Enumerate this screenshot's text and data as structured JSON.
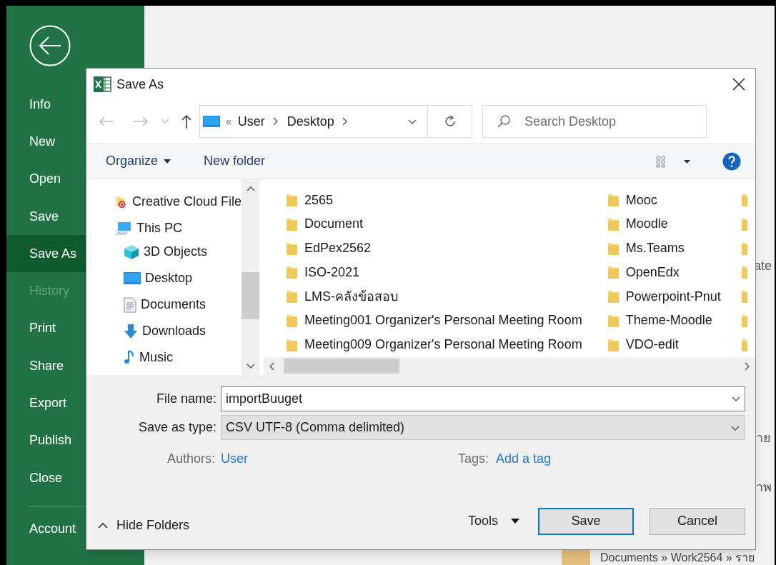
{
  "backstage": {
    "menu": [
      {
        "label": "Info",
        "selected": false,
        "disabled": false
      },
      {
        "label": "New",
        "selected": false,
        "disabled": false
      },
      {
        "label": "Open",
        "selected": false,
        "disabled": false
      },
      {
        "label": "Save",
        "selected": false,
        "disabled": false
      },
      {
        "label": "Save As",
        "selected": true,
        "disabled": false
      },
      {
        "label": "History",
        "selected": false,
        "disabled": true
      },
      {
        "label": "Print",
        "selected": false,
        "disabled": false
      },
      {
        "label": "Share",
        "selected": false,
        "disabled": false
      },
      {
        "label": "Export",
        "selected": false,
        "disabled": false
      },
      {
        "label": "Publish",
        "selected": false,
        "disabled": false
      },
      {
        "label": "Close",
        "selected": false,
        "disabled": false
      }
    ],
    "account": "Account",
    "behind_texts": [
      "ate",
      "าย",
      "าพ"
    ],
    "behind_path": "Documents » Work2564 » ราย"
  },
  "dialog": {
    "title": "Save As",
    "breadcrumb": {
      "overflow": "«",
      "parts": [
        "User",
        "Desktop"
      ]
    },
    "search": {
      "placeholder": "Search Desktop"
    },
    "toolbar": {
      "organize": "Organize",
      "new_folder": "New folder"
    },
    "nav_pane": [
      {
        "label": "Creative Cloud File",
        "kind": "cloud"
      },
      {
        "label": "This PC",
        "kind": "pc",
        "children": [
          {
            "label": "3D Objects",
            "kind": "cube"
          },
          {
            "label": "Desktop",
            "kind": "desktop"
          },
          {
            "label": "Documents",
            "kind": "documents"
          },
          {
            "label": "Downloads",
            "kind": "downloads"
          },
          {
            "label": "Music",
            "kind": "music"
          }
        ]
      }
    ],
    "folders": [
      {
        "label": "2565"
      },
      {
        "label": "Document"
      },
      {
        "label": "EdPex2562"
      },
      {
        "label": "ISO-2021"
      },
      {
        "label": "LMS-คลังข้อสอบ"
      },
      {
        "label": "Meeting001 Organizer's Personal Meeting Room"
      },
      {
        "label": "Meeting009 Organizer's Personal Meeting Room"
      },
      {
        "label": "Mooc"
      },
      {
        "label": "Moodle"
      },
      {
        "label": "Ms.Teams"
      },
      {
        "label": "OpenEdx"
      },
      {
        "label": "Powerpoint-Pnut"
      },
      {
        "label": "Theme-Moodle"
      },
      {
        "label": "VDO-edit"
      }
    ],
    "cut_folders": [
      {
        "kind": "folder"
      },
      {
        "kind": "folder"
      },
      {
        "kind": "folder"
      },
      {
        "kind": "folder"
      },
      {
        "kind": "folder"
      },
      {
        "kind": "folder"
      },
      {
        "kind": "folder"
      }
    ],
    "file_name": {
      "label": "File name:",
      "value": "importBuuget"
    },
    "save_type": {
      "label": "Save as type:",
      "value": "CSV UTF-8 (Comma delimited)"
    },
    "authors": {
      "label": "Authors:",
      "value": "User"
    },
    "tags": {
      "label": "Tags:",
      "value": "Add a tag"
    },
    "hide_folders": "Hide Folders",
    "tools": "Tools",
    "buttons": [
      {
        "label": "Save",
        "default": true
      },
      {
        "label": "Cancel",
        "default": false
      }
    ]
  }
}
